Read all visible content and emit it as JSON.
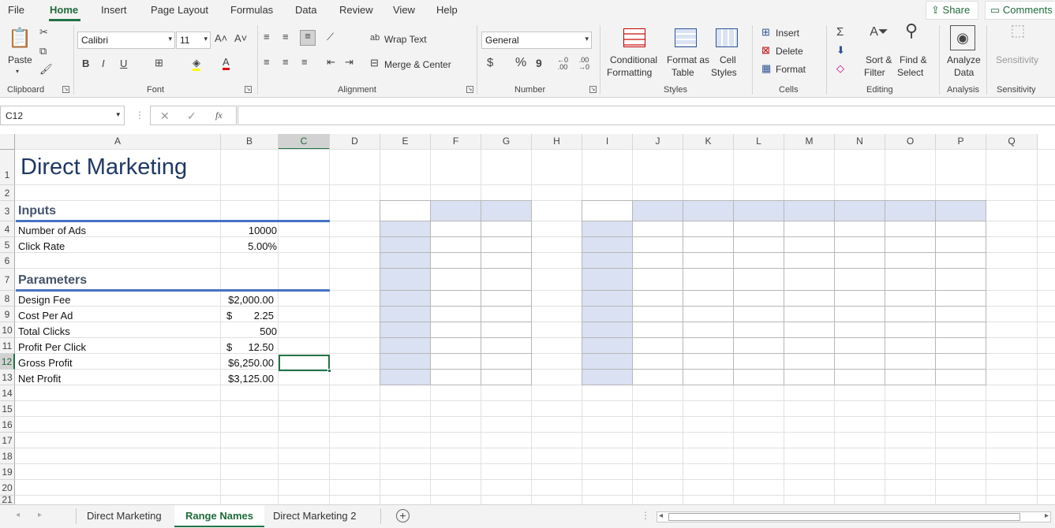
{
  "menu": {
    "tabs": [
      "File",
      "Home",
      "Insert",
      "Page Layout",
      "Formulas",
      "Data",
      "Review",
      "View",
      "Help"
    ],
    "share": "Share",
    "comments": "Comments"
  },
  "ribbon": {
    "clipboard": {
      "paste": "Paste",
      "label": "Clipboard"
    },
    "font": {
      "name": "Calibri",
      "size": "11",
      "label": "Font",
      "bold": "B",
      "italic": "I",
      "underline": "U"
    },
    "alignment": {
      "wrap": "Wrap Text",
      "merge": "Merge & Center",
      "label": "Alignment"
    },
    "number": {
      "format": "General",
      "currency": "$",
      "percent": "%",
      "comma": "9",
      "label": "Number"
    },
    "styles": {
      "cond1": "Conditional",
      "cond2": "Formatting",
      "fmt1": "Format as",
      "fmt2": "Table",
      "cell1": "Cell",
      "cell2": "Styles",
      "label": "Styles"
    },
    "cells": {
      "insert": "Insert",
      "delete": "Delete",
      "format": "Format",
      "label": "Cells"
    },
    "editing": {
      "sort1": "Sort &",
      "sort2": "Filter",
      "find1": "Find &",
      "find2": "Select",
      "label": "Editing"
    },
    "analysis": {
      "a1": "Analyze",
      "a2": "Data",
      "label": "Analysis"
    },
    "sensitivity": {
      "s1": "Sensitivity",
      "label": "Sensitivity"
    }
  },
  "formula_bar": {
    "name_box": "C12",
    "fx": "fx",
    "formula": ""
  },
  "columns": [
    "A",
    "B",
    "C",
    "D",
    "E",
    "F",
    "G",
    "H",
    "I",
    "J",
    "K",
    "L",
    "M",
    "N",
    "O",
    "P",
    "Q"
  ],
  "rows": [
    "1",
    "2",
    "3",
    "4",
    "5",
    "6",
    "7",
    "8",
    "9",
    "10",
    "11",
    "12",
    "13",
    "14",
    "15",
    "16",
    "17",
    "18",
    "19",
    "20",
    "21"
  ],
  "sheet": {
    "title": "Direct Marketing",
    "inputs_header": "Inputs",
    "number_of_ads_label": "Number of Ads",
    "number_of_ads": "10000",
    "click_rate_label": "Click Rate",
    "click_rate": "5.00%",
    "parameters_header": "Parameters",
    "design_fee_label": "Design Fee",
    "design_fee": "$2,000.00",
    "cost_per_ad_label": "Cost Per Ad",
    "cost_per_ad_sym": "$",
    "cost_per_ad": "2.25",
    "total_clicks_label": "Total Clicks",
    "total_clicks": "500",
    "profit_per_click_label": "Profit Per Click",
    "profit_per_click_sym": "$",
    "profit_per_click": "12.50",
    "gross_profit_label": "Gross Profit",
    "gross_profit": "$6,250.00",
    "net_profit_label": "Net Profit",
    "net_profit": "$3,125.00"
  },
  "sheet_tabs": [
    "Direct Marketing",
    "Range Names",
    "Direct Marketing 2"
  ],
  "colors": {
    "accent": "#217346",
    "table_fill": "#d9e1f2",
    "title": "#1f3864",
    "section_rule": "#4472c4"
  }
}
